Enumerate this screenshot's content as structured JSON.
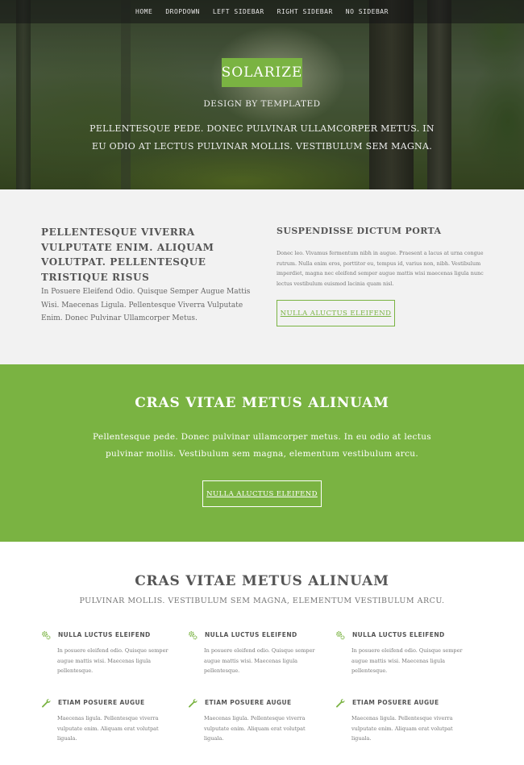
{
  "nav": {
    "items": [
      "Home",
      "Dropdown",
      "Left Sidebar",
      "Right Sidebar",
      "No Sidebar"
    ]
  },
  "hero": {
    "logo": "SOLARIZE",
    "tagline": "Design by TEMPLATED",
    "description": "Pellentesque pede. Donec pulvinar ullamcorper metus. In eu odio at lectus pulvinar mollis. Vestibulum sem magna."
  },
  "intro": {
    "heading": "Pellentesque viverra vulputate enim. Aliquam volutpat. Pellentesque tristique risus",
    "text": "In Posuere Eleifend Odio. Quisque Semper Augue Mattis Wisi. Maecenas Ligula. Pellentesque Viverra Vulputate Enim. Donec Pulvinar Ullamcorper Metus.",
    "right_title": "Suspendisse dictum porta",
    "right_text": "Donec leo. Vivamus fermentum nibh in augue. Praesent a lacus at urna congue rutrum. Nulla enim eros, porttitor eu, tempus id, varius non, nibh. Vestibulum imperdiet, magna nec eleifend semper augue mattis wisi maecenas ligula nunc lectus vestibulum euismod lacinia quam nisl.",
    "button": "Nulla aluctus eleifend"
  },
  "banner": {
    "title": "Cras vitae metus alinuam",
    "text": "Pellentesque pede. Donec pulvinar ullamcorper metus. In eu odio at lectus pulvinar mollis. Vestibulum sem magna, elementum vestibulum arcu.",
    "button": "Nulla aluctus eleifend"
  },
  "features": {
    "title": "Cras vitae metus alinuam",
    "subtitle": "Pulvinar mollis. Vestibulum sem magna, elementum vestibulum arcu.",
    "items": [
      {
        "icon": "cogs-icon",
        "title": "Nulla luctus eleifend",
        "text": "In posuere eleifend odio. Quisque semper augue mattis wisi. Maecenas ligula pellentesque."
      },
      {
        "icon": "cogs-icon",
        "title": "Nulla luctus eleifend",
        "text": "In posuere eleifend odio. Quisque semper augue mattis wisi. Maecenas ligula pellentesque."
      },
      {
        "icon": "cogs-icon",
        "title": "Nulla luctus eleifend",
        "text": "In posuere eleifend odio. Quisque semper augue mattis wisi. Maecenas ligula pellentesque."
      },
      {
        "icon": "wrench-icon",
        "title": "Etiam posuere augue",
        "text": "Maecenas ligula. Pellentesque viverra vulputate enim. Aliquam erat volutpat liguala."
      },
      {
        "icon": "wrench-icon",
        "title": "Etiam posuere augue",
        "text": "Maecenas ligula. Pellentesque viverra vulputate enim. Aliquam erat volutpat liguala."
      },
      {
        "icon": "wrench-icon",
        "title": "Etiam posuere augue",
        "text": "Maecenas ligula. Pellentesque viverra vulputate enim. Aliquam erat volutpat liguala."
      }
    ]
  },
  "colors": {
    "accent": "#7ab342",
    "light_bg": "#f2f2f2",
    "text": "#555555"
  }
}
